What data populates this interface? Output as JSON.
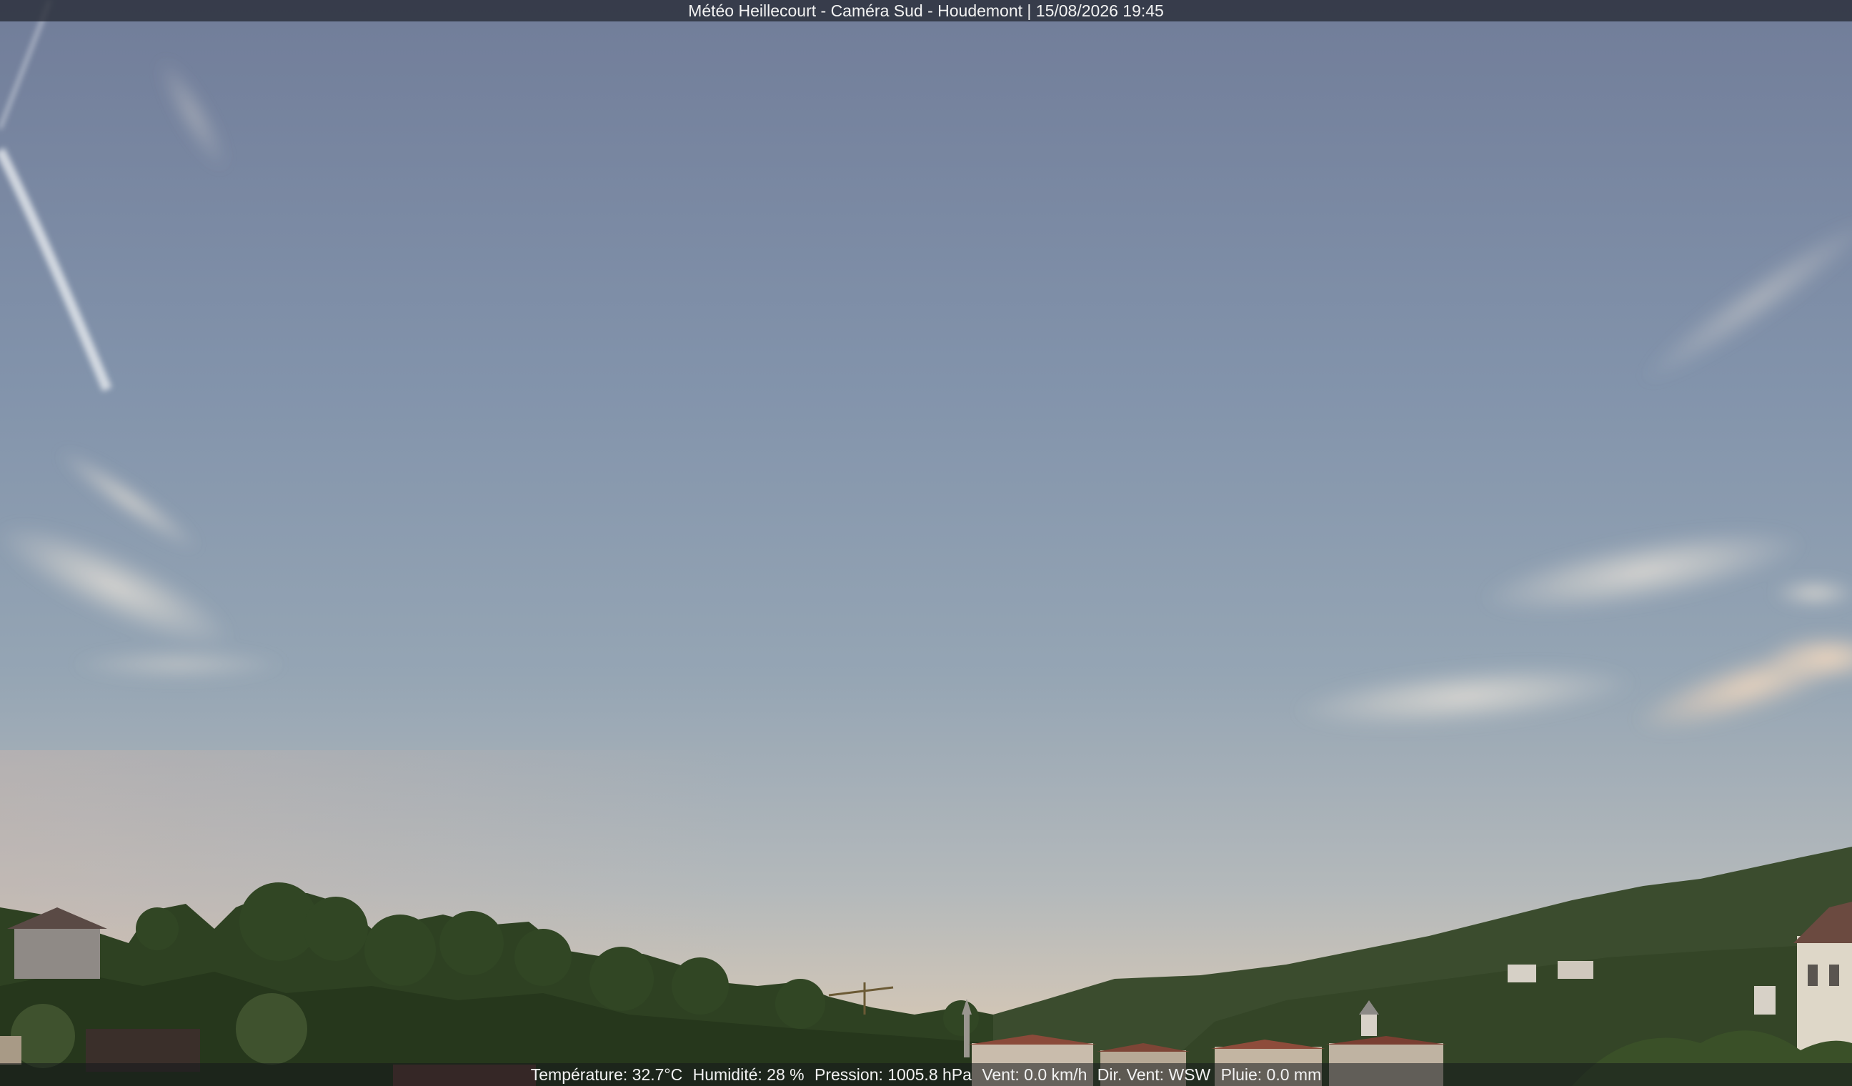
{
  "header": {
    "title": "Météo Heillecourt - Caméra Sud - Houdemont | 15/08/2026 19:45"
  },
  "readings": {
    "temperature": "Température: 32.7°C",
    "humidity": "Humidité: 28 %",
    "pressure": "Pression: 1005.8 hPa",
    "wind_speed": "Vent: 0.0 km/h",
    "wind_direction": "Dir. Vent: WSW",
    "rain": "Pluie: 0.0 mm"
  },
  "colors": {
    "sky_top": "#74819c",
    "sky_middle": "#8d9db0",
    "sky_horizon": "#c8c3b8",
    "trees": "#2f4424",
    "roofs": "#8a4a3a"
  }
}
